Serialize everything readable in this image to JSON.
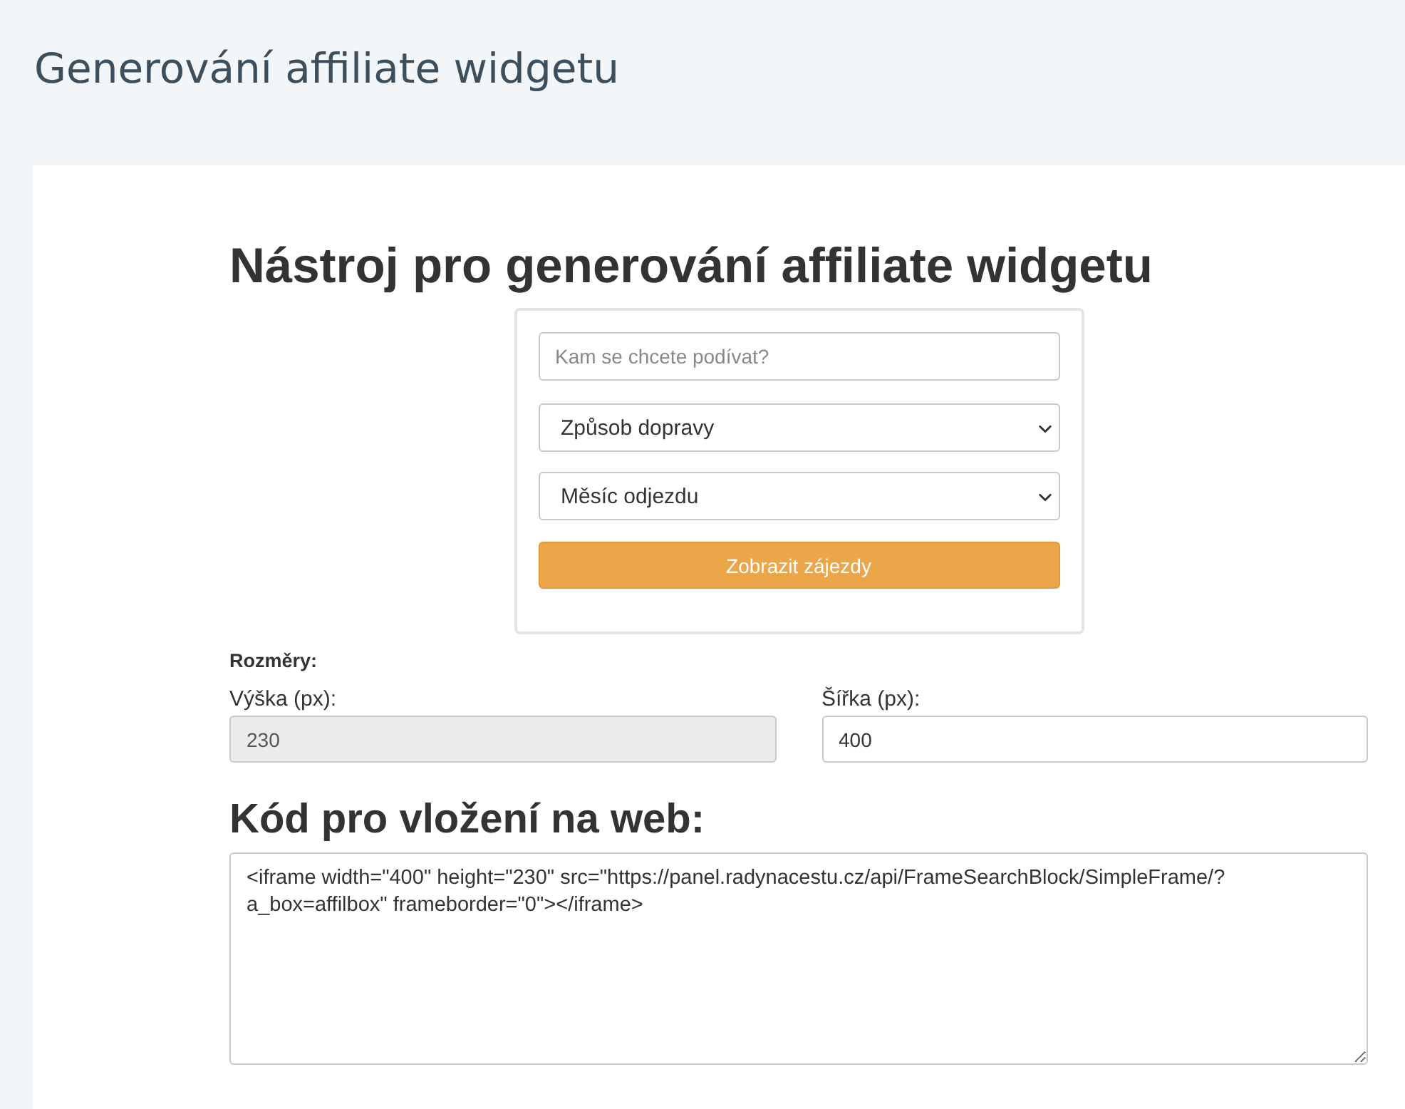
{
  "page": {
    "title": "Generování affiliate widgetu"
  },
  "tool": {
    "heading": "Nástroj pro generování affiliate widgetu",
    "widget": {
      "destination": {
        "placeholder": "Kam se chcete podívat?"
      },
      "selects": [
        {
          "value": "Způsob dopravy"
        },
        {
          "value": "Měsíc odjezdu"
        }
      ],
      "submit": "Zobrazit zájezdy"
    },
    "dimensions": {
      "label": "Rozměry:",
      "fields": [
        {
          "label": "Výška (px):",
          "value": "230",
          "disabled": true
        },
        {
          "label": "Šířka (px):",
          "value": "400",
          "disabled": false
        }
      ]
    },
    "embed": {
      "heading": "Kód pro vložení na web:",
      "code": "<iframe width=\"400\" height=\"230\" src=\"https://panel.radynacestu.cz/api/FrameSearchBlock/SimpleFrame/?a_box=affilbox\" frameborder=\"0\"></iframe>"
    }
  }
}
